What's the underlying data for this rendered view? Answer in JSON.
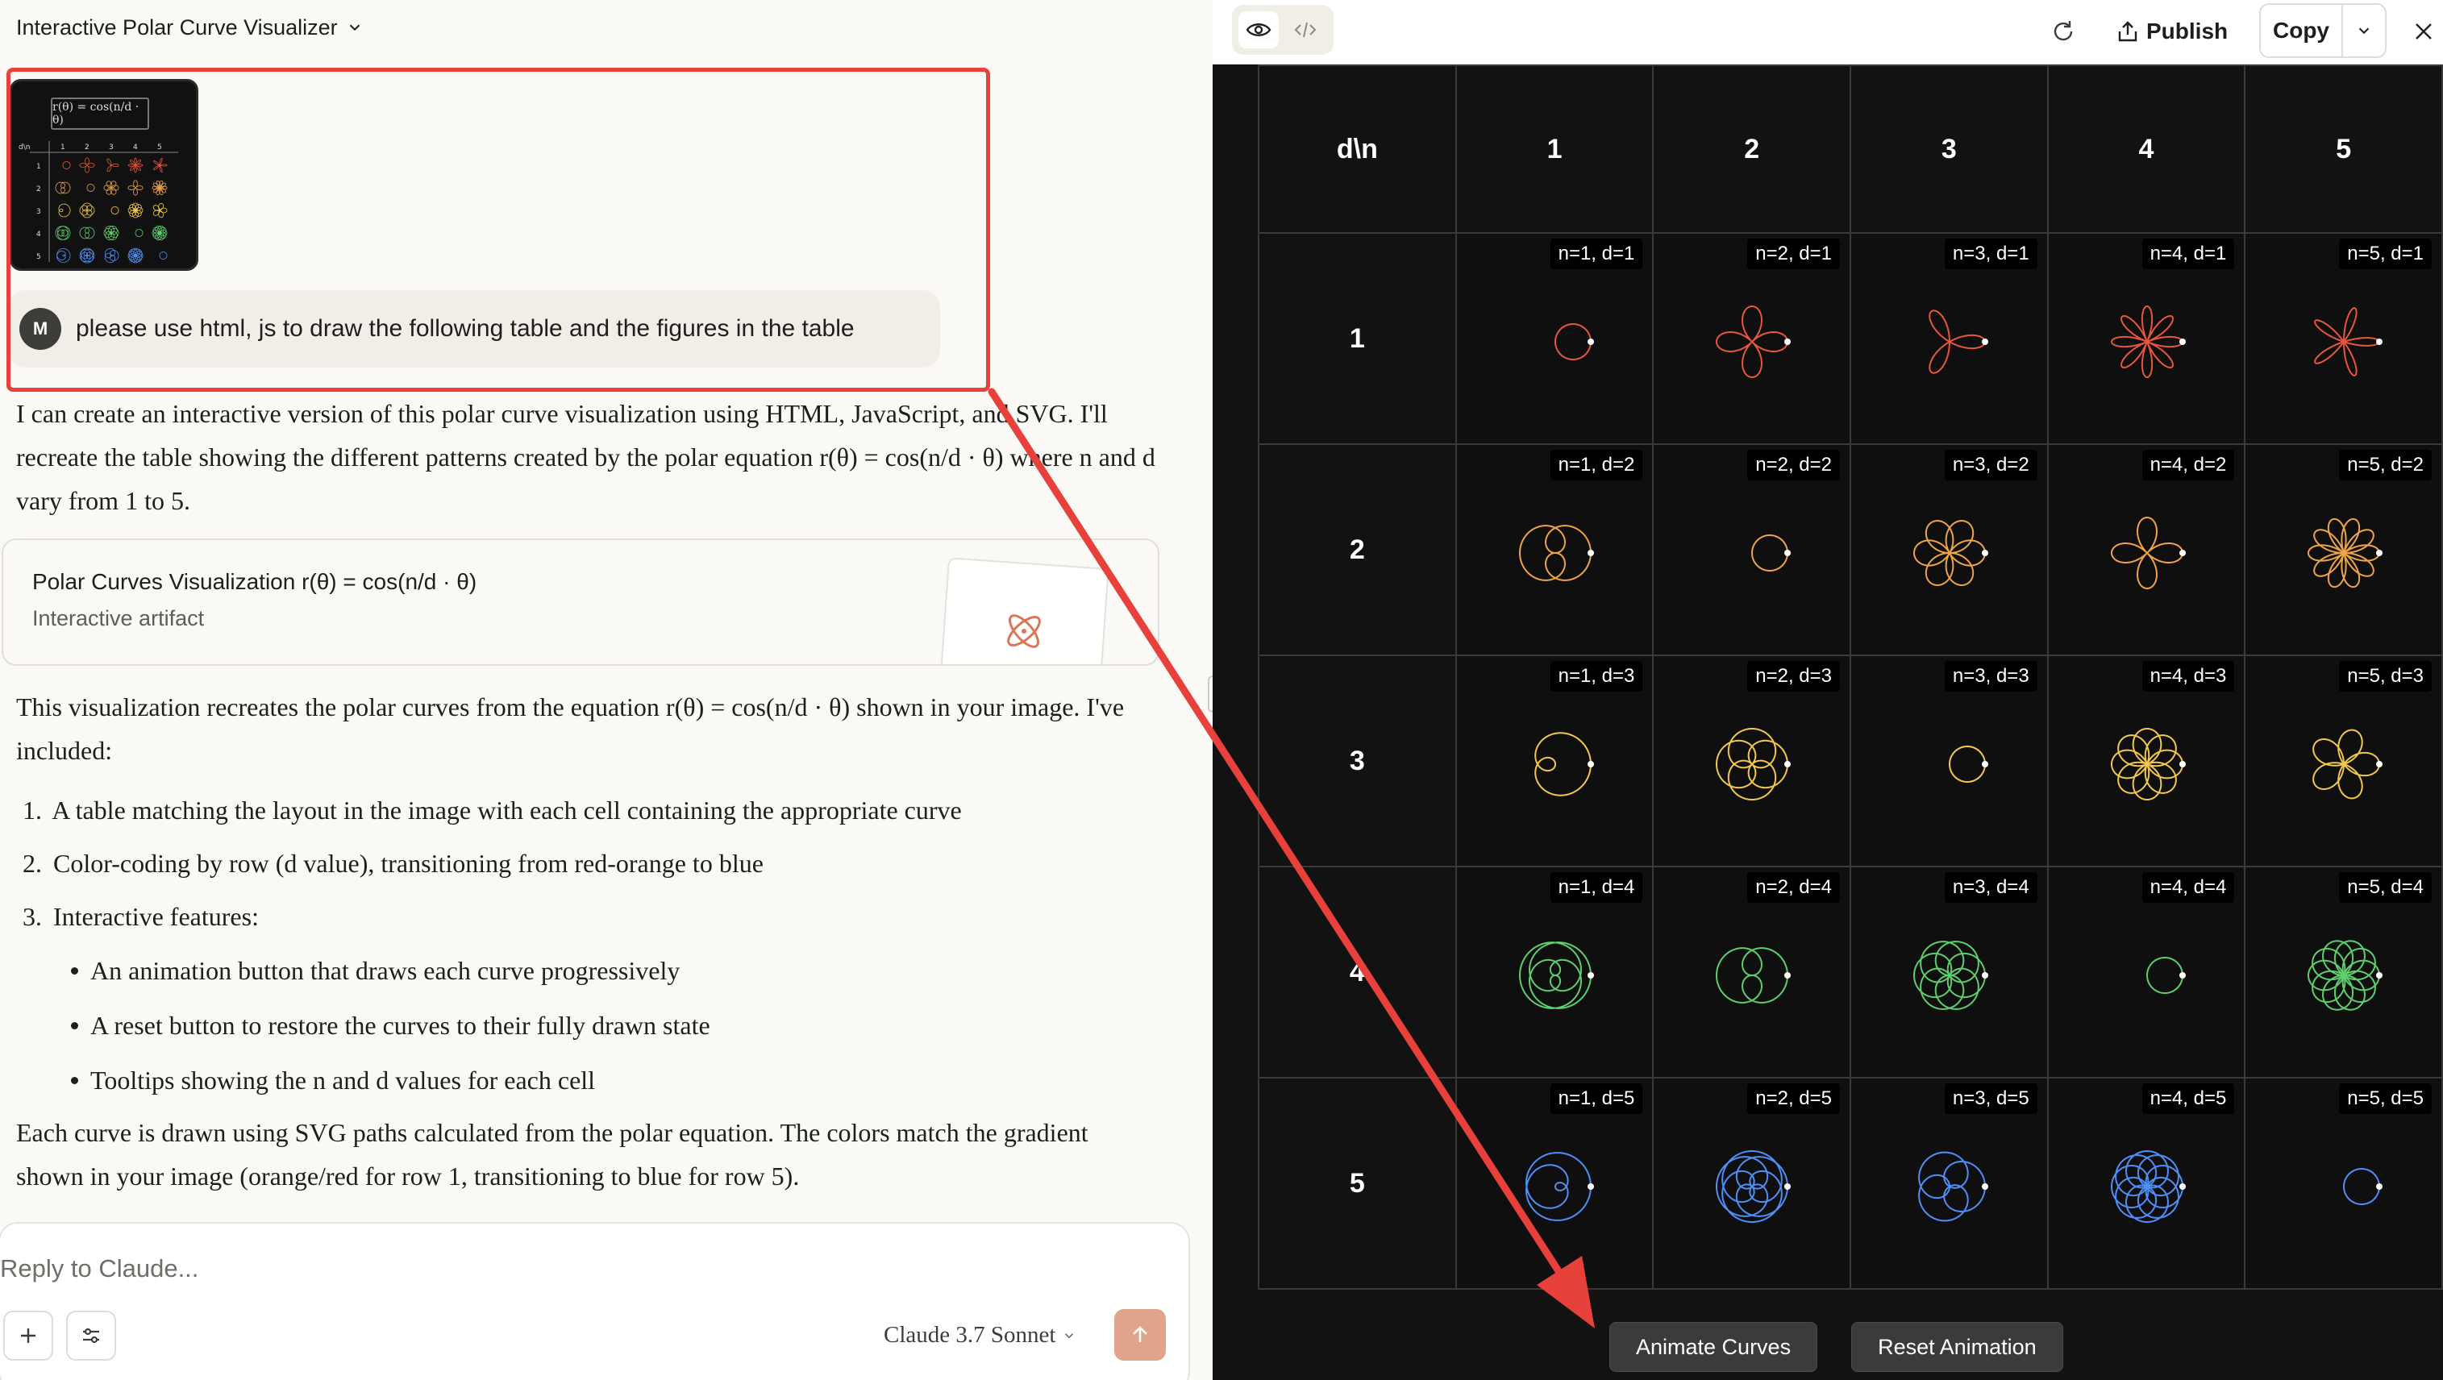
{
  "chat": {
    "title": "Interactive Polar Curve Visualizer",
    "thumbnail": {
      "formula": "r(θ) = cos(n/d · θ)",
      "header": "d\\n",
      "col_labels": [
        "1",
        "2",
        "3",
        "4",
        "5"
      ],
      "row_labels": [
        "1",
        "2",
        "3",
        "4",
        "5"
      ]
    },
    "user": {
      "avatar": "M",
      "message": "please use html, js to draw the following table and the figures in the table"
    },
    "reply_intro": "I can create an interactive version of this polar curve visualization using HTML, JavaScript, and SVG. I'll recreate the table showing the different patterns created by the polar equation r(θ) = cos(n/d · θ) where n and d vary from 1 to 5.",
    "artifact": {
      "title": "Polar Curves Visualization r(θ) = cos(n/d · θ)",
      "subtitle": "Interactive artifact",
      "icon": "atom-icon"
    },
    "reply_body": "This visualization recreates the polar curves from the equation r(θ) = cos(n/d · θ) shown in your image. I've included:",
    "list": [
      "A table matching the layout in the image with each cell containing the appropriate curve",
      "Color-coding by row (d value), transitioning from red-orange to blue",
      "Interactive features:"
    ],
    "sub_list": [
      "An animation button that draws each curve progressively",
      "A reset button to restore the curves to their fully drawn state",
      "Tooltips showing the n and d values for each cell"
    ],
    "reply_outro": "Each curve is drawn using SVG paths calculated from the polar equation. The colors match the gradient shown in your image (orange/red for row 1, transitioning to blue for row 5).",
    "composer": {
      "placeholder": "Reply to Claude...",
      "model": "Claude 3.7 Sonnet"
    }
  },
  "artifact_pane": {
    "toolbar": {
      "publish": "Publish",
      "copy": "Copy"
    },
    "table": {
      "corner": "d\\n",
      "n_values": [
        "1",
        "2",
        "3",
        "4",
        "5"
      ],
      "d_values": [
        "1",
        "2",
        "3",
        "4",
        "5"
      ],
      "row_colors": [
        "#e8573c",
        "#f0a44a",
        "#f2c94c",
        "#5fcf6e",
        "#4f8ff7"
      ],
      "cell_labels": [
        [
          "n=1, d=1",
          "n=2, d=1",
          "n=3, d=1",
          "n=4, d=1",
          "n=5, d=1"
        ],
        [
          "n=1, d=2",
          "n=2, d=2",
          "n=3, d=2",
          "n=4, d=2",
          "n=5, d=2"
        ],
        [
          "n=1, d=3",
          "n=2, d=3",
          "n=3, d=3",
          "n=4, d=3",
          "n=5, d=3"
        ],
        [
          "n=1, d=4",
          "n=2, d=4",
          "n=3, d=4",
          "n=4, d=4",
          "n=5, d=4"
        ],
        [
          "n=1, d=5",
          "n=2, d=5",
          "n=3, d=5",
          "n=4, d=5",
          "n=5, d=5"
        ]
      ]
    },
    "buttons": {
      "animate": "Animate Curves",
      "reset": "Reset Animation"
    }
  },
  "annotation": {
    "box_color": "#e8403a",
    "arrow_color": "#e8403a"
  }
}
